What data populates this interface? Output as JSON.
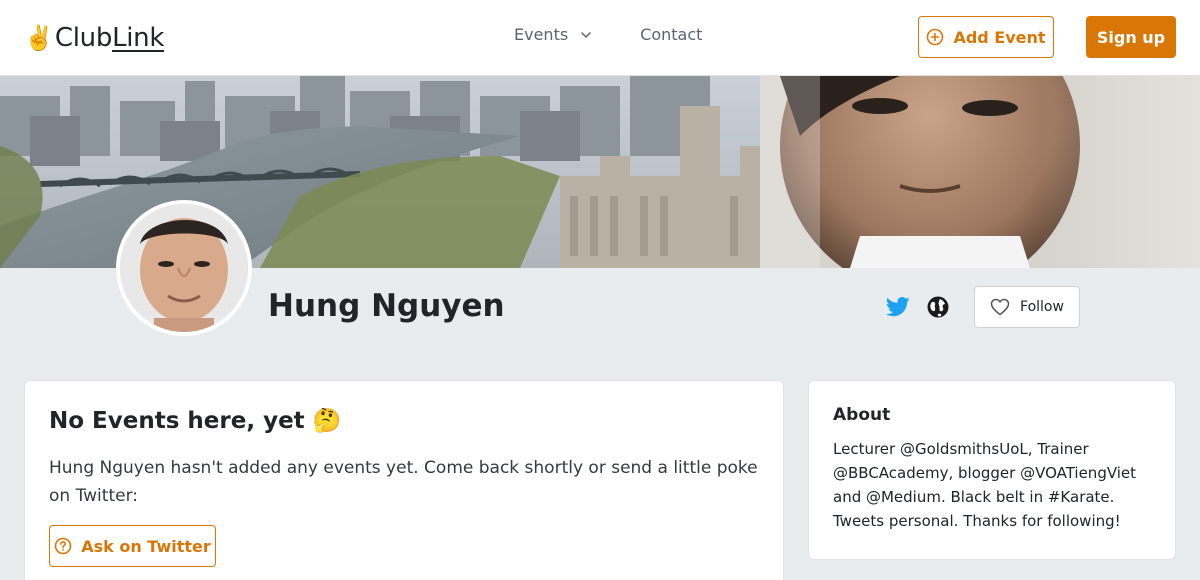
{
  "header": {
    "logo_emoji": "✌️",
    "logo_part1": "Club",
    "logo_part2": "Link",
    "nav": {
      "events_label": "Events",
      "contact_label": "Contact"
    },
    "add_event_label": "Add Event",
    "signup_label": "Sign up"
  },
  "profile": {
    "name": "Hung Nguyen",
    "follow_label": "Follow"
  },
  "events": {
    "title": "No Events here, yet 🤔",
    "message": "Hung Nguyen hasn't added any events yet. Come back shortly or send a little poke on Twitter:",
    "ask_label": "Ask on Twitter"
  },
  "about": {
    "title": "About",
    "bio": "Lecturer @GoldsmithsUoL, Trainer @BBCAcademy, blogger @VOATiengViet and @Medium. Black belt in #Karate. Tweets personal. Thanks for following!"
  },
  "colors": {
    "accent": "#d97706",
    "twitter": "#1da1f2",
    "page_background": "#e9ecef"
  },
  "icons": {
    "events_dropdown": "chevron-down-icon",
    "add_event": "plus-circle-icon",
    "twitter": "twitter-icon",
    "website": "globe-icon",
    "follow": "heart-icon",
    "ask": "question-circle-icon"
  }
}
